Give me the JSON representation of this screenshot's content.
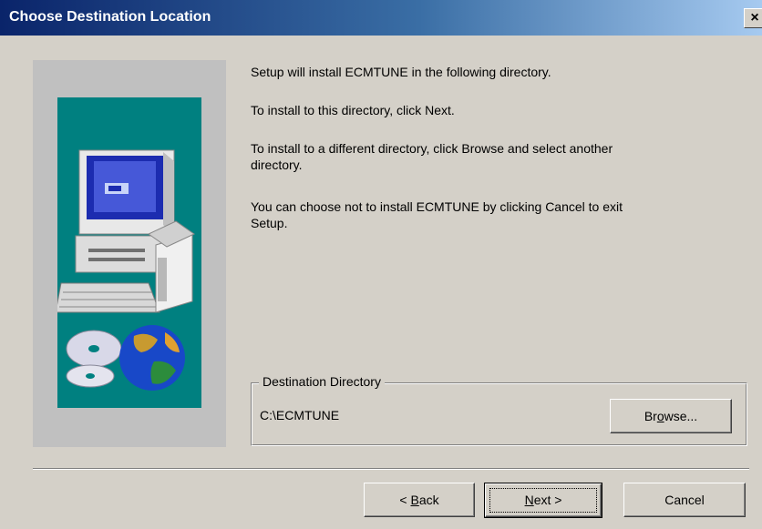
{
  "window": {
    "title": "Choose Destination Location",
    "close_glyph": "×"
  },
  "colors": {
    "title_gradient_start": "#0a246a",
    "title_gradient_end": "#a6caf0",
    "dialog_bg": "#d4d0c8",
    "image_bg": "#008080"
  },
  "icons": {
    "setup_illustration": "computer-with-box-cds-globe"
  },
  "body": {
    "line1": "Setup will install ECMTUNE in the following directory.",
    "line2": "To install to this directory, click Next.",
    "line3a": "To install to a different directory, click Browse and select another",
    "line3b": "directory.",
    "line4a": "You can choose not to install ECMTUNE by clicking Cancel to exit",
    "line4b": "Setup."
  },
  "destination": {
    "legend": "Destination Directory",
    "path": "C:\\ECMTUNE",
    "browse_pre": "Br",
    "browse_mnemonic": "o",
    "browse_post": "wse..."
  },
  "buttons": {
    "back_prefix": "< ",
    "back_mnemonic": "B",
    "back_rest": "ack",
    "next_mnemonic": "N",
    "next_rest": "ext >",
    "cancel": "Cancel"
  }
}
